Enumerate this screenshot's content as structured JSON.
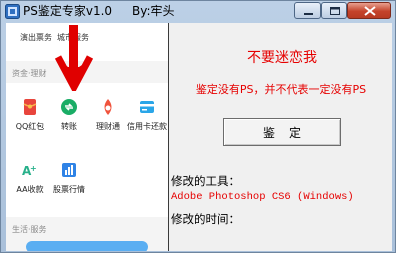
{
  "window": {
    "title": "PS鉴定专家v1.0",
    "author": "By:牢头",
    "buttons": {
      "minimize": "minimize-icon",
      "maximize": "maximize-icon",
      "close": "close-icon"
    }
  },
  "preview": {
    "top_items": [
      "演出票务",
      "城市服务"
    ],
    "section1": "资金·理财",
    "tiles": [
      {
        "label": "QQ红包",
        "icon": "red-envelope-icon",
        "color": "#e8453c"
      },
      {
        "label": "转账",
        "icon": "transfer-icon",
        "color": "#1aad66"
      },
      {
        "label": "理财通",
        "icon": "wealth-icon",
        "color": "#f0533c"
      },
      {
        "label": "信用卡还款",
        "icon": "credit-card-icon",
        "color": "#2aa6e8"
      },
      {
        "label": "AA收款",
        "icon": "aa-icon",
        "color": "#27b08a"
      },
      {
        "label": "股票行情",
        "icon": "stock-icon",
        "color": "#2f83e6"
      }
    ],
    "section2": "生活·服务",
    "arrow_color": "#e00000"
  },
  "panel": {
    "warning_title": "不要迷恋我",
    "warning_note": "鉴定没有PS，并不代表一定没有PS",
    "check_button": "鉴定",
    "tool_label": "修改的工具：",
    "tool_value": "Adobe Photoshop CS6 (Windows)",
    "time_label": "修改的时间：",
    "time_value": ""
  },
  "colors": {
    "accent_red": "#e60000",
    "frame": "#a9c0da"
  }
}
